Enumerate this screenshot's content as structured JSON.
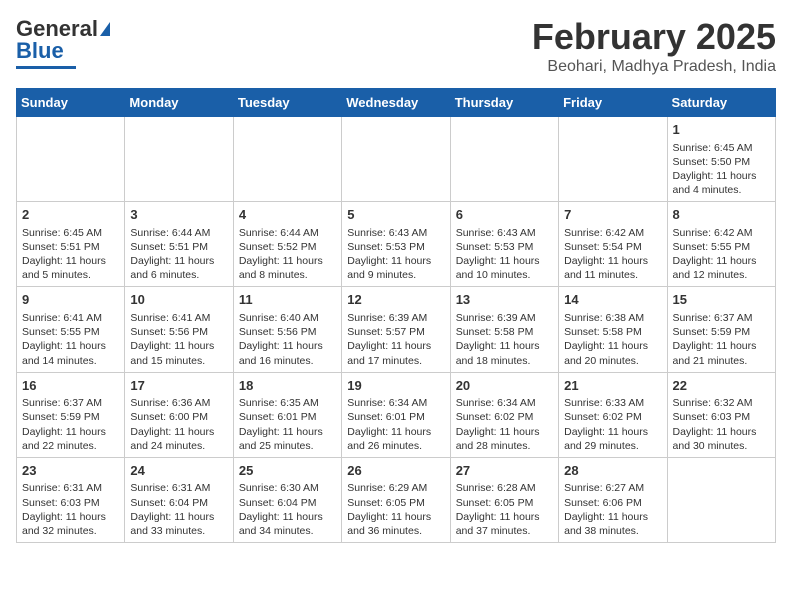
{
  "header": {
    "logo_general": "General",
    "logo_blue": "Blue",
    "month": "February 2025",
    "location": "Beohari, Madhya Pradesh, India"
  },
  "weekdays": [
    "Sunday",
    "Monday",
    "Tuesday",
    "Wednesday",
    "Thursday",
    "Friday",
    "Saturday"
  ],
  "weeks": [
    [
      {
        "day": "",
        "info": ""
      },
      {
        "day": "",
        "info": ""
      },
      {
        "day": "",
        "info": ""
      },
      {
        "day": "",
        "info": ""
      },
      {
        "day": "",
        "info": ""
      },
      {
        "day": "",
        "info": ""
      },
      {
        "day": "1",
        "info": "Sunrise: 6:45 AM\nSunset: 5:50 PM\nDaylight: 11 hours and 4 minutes."
      }
    ],
    [
      {
        "day": "2",
        "info": "Sunrise: 6:45 AM\nSunset: 5:51 PM\nDaylight: 11 hours and 5 minutes."
      },
      {
        "day": "3",
        "info": "Sunrise: 6:44 AM\nSunset: 5:51 PM\nDaylight: 11 hours and 6 minutes."
      },
      {
        "day": "4",
        "info": "Sunrise: 6:44 AM\nSunset: 5:52 PM\nDaylight: 11 hours and 8 minutes."
      },
      {
        "day": "5",
        "info": "Sunrise: 6:43 AM\nSunset: 5:53 PM\nDaylight: 11 hours and 9 minutes."
      },
      {
        "day": "6",
        "info": "Sunrise: 6:43 AM\nSunset: 5:53 PM\nDaylight: 11 hours and 10 minutes."
      },
      {
        "day": "7",
        "info": "Sunrise: 6:42 AM\nSunset: 5:54 PM\nDaylight: 11 hours and 11 minutes."
      },
      {
        "day": "8",
        "info": "Sunrise: 6:42 AM\nSunset: 5:55 PM\nDaylight: 11 hours and 12 minutes."
      }
    ],
    [
      {
        "day": "9",
        "info": "Sunrise: 6:41 AM\nSunset: 5:55 PM\nDaylight: 11 hours and 14 minutes."
      },
      {
        "day": "10",
        "info": "Sunrise: 6:41 AM\nSunset: 5:56 PM\nDaylight: 11 hours and 15 minutes."
      },
      {
        "day": "11",
        "info": "Sunrise: 6:40 AM\nSunset: 5:56 PM\nDaylight: 11 hours and 16 minutes."
      },
      {
        "day": "12",
        "info": "Sunrise: 6:39 AM\nSunset: 5:57 PM\nDaylight: 11 hours and 17 minutes."
      },
      {
        "day": "13",
        "info": "Sunrise: 6:39 AM\nSunset: 5:58 PM\nDaylight: 11 hours and 18 minutes."
      },
      {
        "day": "14",
        "info": "Sunrise: 6:38 AM\nSunset: 5:58 PM\nDaylight: 11 hours and 20 minutes."
      },
      {
        "day": "15",
        "info": "Sunrise: 6:37 AM\nSunset: 5:59 PM\nDaylight: 11 hours and 21 minutes."
      }
    ],
    [
      {
        "day": "16",
        "info": "Sunrise: 6:37 AM\nSunset: 5:59 PM\nDaylight: 11 hours and 22 minutes."
      },
      {
        "day": "17",
        "info": "Sunrise: 6:36 AM\nSunset: 6:00 PM\nDaylight: 11 hours and 24 minutes."
      },
      {
        "day": "18",
        "info": "Sunrise: 6:35 AM\nSunset: 6:01 PM\nDaylight: 11 hours and 25 minutes."
      },
      {
        "day": "19",
        "info": "Sunrise: 6:34 AM\nSunset: 6:01 PM\nDaylight: 11 hours and 26 minutes."
      },
      {
        "day": "20",
        "info": "Sunrise: 6:34 AM\nSunset: 6:02 PM\nDaylight: 11 hours and 28 minutes."
      },
      {
        "day": "21",
        "info": "Sunrise: 6:33 AM\nSunset: 6:02 PM\nDaylight: 11 hours and 29 minutes."
      },
      {
        "day": "22",
        "info": "Sunrise: 6:32 AM\nSunset: 6:03 PM\nDaylight: 11 hours and 30 minutes."
      }
    ],
    [
      {
        "day": "23",
        "info": "Sunrise: 6:31 AM\nSunset: 6:03 PM\nDaylight: 11 hours and 32 minutes."
      },
      {
        "day": "24",
        "info": "Sunrise: 6:31 AM\nSunset: 6:04 PM\nDaylight: 11 hours and 33 minutes."
      },
      {
        "day": "25",
        "info": "Sunrise: 6:30 AM\nSunset: 6:04 PM\nDaylight: 11 hours and 34 minutes."
      },
      {
        "day": "26",
        "info": "Sunrise: 6:29 AM\nSunset: 6:05 PM\nDaylight: 11 hours and 36 minutes."
      },
      {
        "day": "27",
        "info": "Sunrise: 6:28 AM\nSunset: 6:05 PM\nDaylight: 11 hours and 37 minutes."
      },
      {
        "day": "28",
        "info": "Sunrise: 6:27 AM\nSunset: 6:06 PM\nDaylight: 11 hours and 38 minutes."
      },
      {
        "day": "",
        "info": ""
      }
    ]
  ]
}
